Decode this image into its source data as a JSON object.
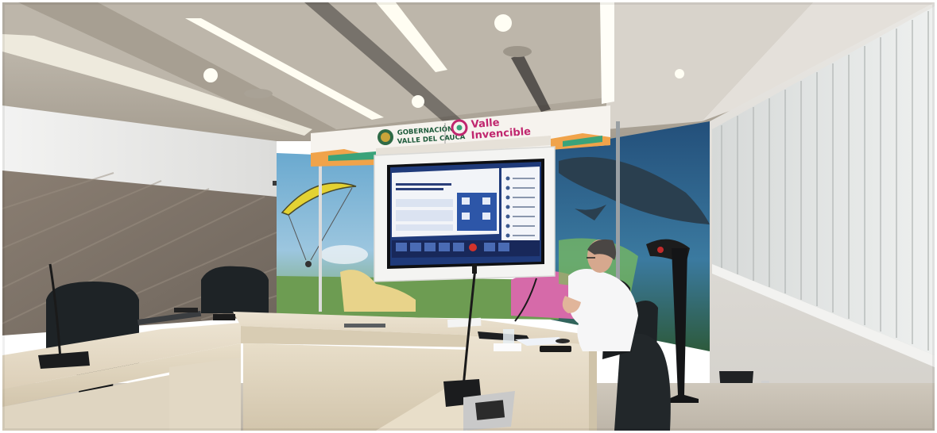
{
  "scene": {
    "type": "photograph",
    "subject": "government conference room with video call on wall screen"
  },
  "banner": {
    "org_line1": "GOBERNACIÓN",
    "org_line2": "VALLE DEL CAUCA",
    "slogan_line1": "Valle",
    "slogan_line2": "Invencible"
  },
  "colors": {
    "banner_bg": "#f6f3ee",
    "banner_text": "#1d5a3a",
    "slogan": "#c0266e",
    "screen_bg": "#1f3a7a",
    "wall_mural_sky": "#5fa0c6",
    "table": "#e6dcc8",
    "chairs": "#1e2326"
  }
}
